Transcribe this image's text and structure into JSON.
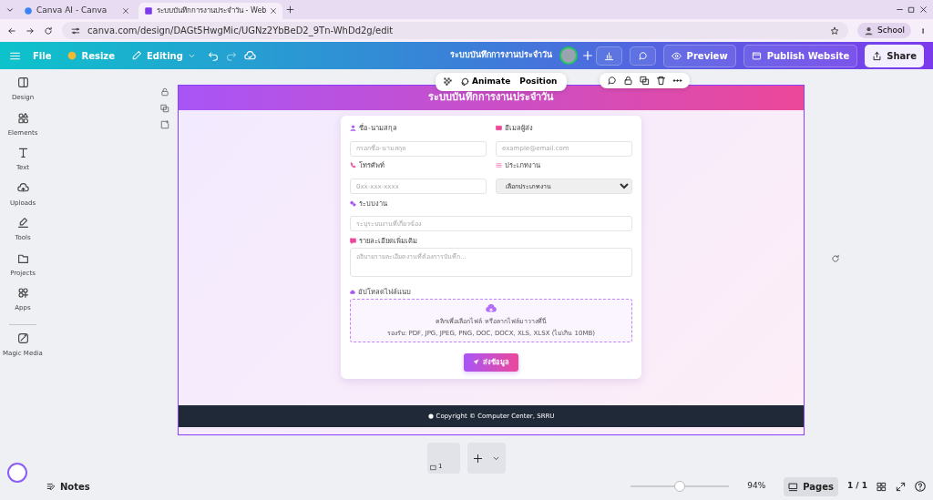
{
  "browser": {
    "tabs": [
      {
        "title": "Canva AI - Canva",
        "selected": false
      },
      {
        "title": "ระบบบันทึกการงานประจำวัน - Web",
        "selected": true
      }
    ],
    "url": "canva.com/design/DAGt5HwgMic/UGNz2YbBeD2_9Tn-WhDd2g/edit",
    "profile": "School"
  },
  "editor": {
    "menu": [
      {
        "label": "File",
        "kind": "text"
      },
      {
        "label": "Resize",
        "kind": "resize"
      },
      {
        "label": "Editing",
        "kind": "editing"
      }
    ],
    "design_title": "ระบบบันทึกการงานประจำวัน",
    "actions": [
      {
        "label": "Preview",
        "kind": "preview"
      },
      {
        "label": "Publish Website",
        "kind": "publish"
      },
      {
        "label": "Share",
        "kind": "share"
      }
    ]
  },
  "sidebar": {
    "items": [
      {
        "label": "Design",
        "kind": "design"
      },
      {
        "label": "Elements",
        "kind": "elements"
      },
      {
        "label": "Text",
        "kind": "text"
      },
      {
        "label": "Uploads",
        "kind": "uploads"
      },
      {
        "label": "Tools",
        "kind": "tools"
      },
      {
        "label": "Projects",
        "kind": "projects"
      },
      {
        "label": "Apps",
        "kind": "apps"
      },
      {
        "label": "Magic Media",
        "kind": "magic"
      }
    ]
  },
  "element_toolbar": {
    "buttons": [
      "Animate",
      "Position"
    ]
  },
  "page": {
    "header": "ระบบบันทึกการงานประจำวัน",
    "fields": [
      {
        "label": "ชื่อ-นามสกุล",
        "placeholder": "กรอกชื่อ-นามสกุล",
        "kind": "input"
      },
      {
        "label": "อีเมลผู้ส่ง",
        "placeholder": "example@email.com",
        "kind": "input"
      },
      {
        "label": "โทรศัพท์",
        "placeholder": "0xx-xxx-xxxx",
        "kind": "input"
      },
      {
        "label": "ประเภทงาน",
        "value": "เลือกประเภทงาน",
        "kind": "select"
      },
      {
        "label": "ระบบงาน",
        "placeholder": "ระบุระบบงานที่เกี่ยวข้อง",
        "kind": "input"
      },
      {
        "label": "รายละเอียดเพิ่มเติม",
        "placeholder": "อธิบายรายละเอียดงานที่ต้องการบันทึก...",
        "kind": "textarea"
      }
    ],
    "upload": {
      "label": "อัปโหลดไฟล์แนบ",
      "prompt": "คลิกเพื่อเลือกไฟล์ หรือลากไฟล์มาวางที่นี่",
      "hint": "รองรับ: PDF, JPG, JPEG, PNG, DOC, DOCX, XLS, XLSX (ไม่เกิน 10MB)"
    },
    "submit": "ส่งข้อมูล",
    "footer": "Copyright © Computer Center, SRRU"
  },
  "pages": {
    "thumb_number": "1"
  },
  "status_bar": {
    "notes": "Notes",
    "zoom": {
      "level": 0.5,
      "reading": "94%"
    },
    "pages_button": "Pages",
    "page_count": "1 / 1"
  }
}
